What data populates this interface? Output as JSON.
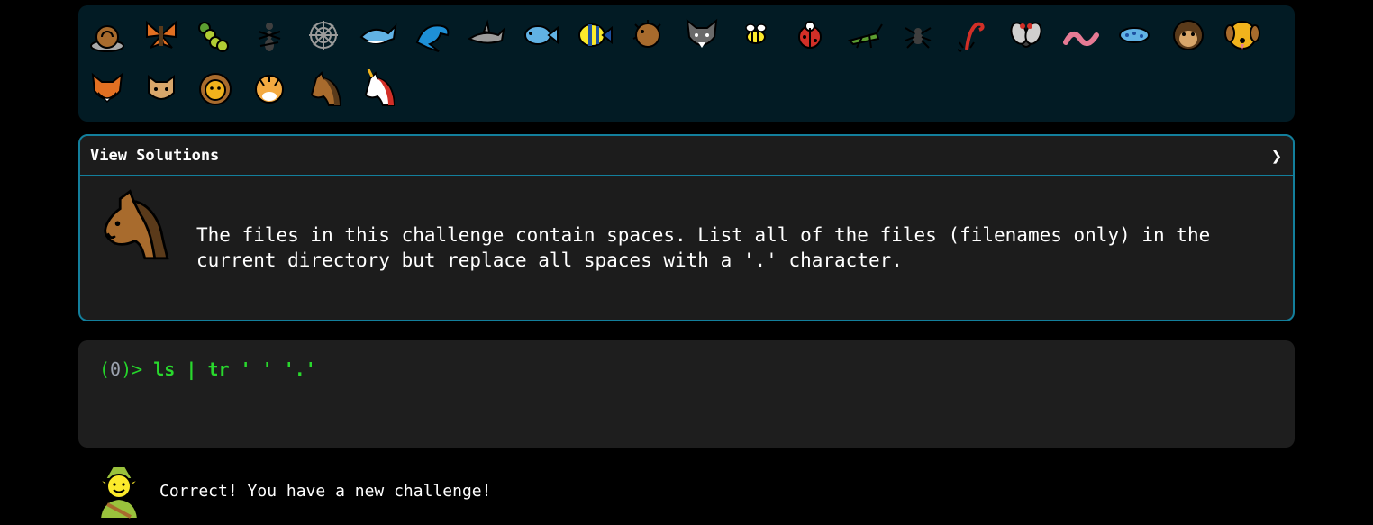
{
  "animals": [
    {
      "icon": "snail-icon"
    },
    {
      "icon": "butterfly-icon"
    },
    {
      "icon": "caterpillar-icon"
    },
    {
      "icon": "ant-icon"
    },
    {
      "icon": "spider-web-icon"
    },
    {
      "icon": "whale-icon"
    },
    {
      "icon": "dolphin-icon"
    },
    {
      "icon": "shark-icon"
    },
    {
      "icon": "fish-icon"
    },
    {
      "icon": "tropical-fish-icon"
    },
    {
      "icon": "blowfish-icon"
    },
    {
      "icon": "wolf-icon"
    },
    {
      "icon": "bee-icon"
    },
    {
      "icon": "ladybug-icon"
    },
    {
      "icon": "cricket-icon"
    },
    {
      "icon": "spider-icon"
    },
    {
      "icon": "scorpion-icon"
    },
    {
      "icon": "fly-icon"
    },
    {
      "icon": "worm-icon"
    },
    {
      "icon": "microbe-icon"
    },
    {
      "icon": "monkey-icon"
    },
    {
      "icon": "dog-icon"
    },
    {
      "icon": "fox-icon"
    },
    {
      "icon": "cat-icon"
    },
    {
      "icon": "lion-icon"
    },
    {
      "icon": "tiger-icon"
    },
    {
      "icon": "horse-icon"
    },
    {
      "icon": "unicorn-icon"
    }
  ],
  "solutions": {
    "title": "View Solutions",
    "chevron": "❯",
    "description": "The files in this challenge contain spaces. List all of the files (filenames only) in the\ncurrent directory but replace all spaces with a '.' character."
  },
  "terminal": {
    "prompt_open": "(",
    "prompt_num": "0",
    "prompt_close": ")>",
    "command": "ls | tr ' ' '.'"
  },
  "feedback": {
    "message": "Correct! You have a new challenge!"
  }
}
